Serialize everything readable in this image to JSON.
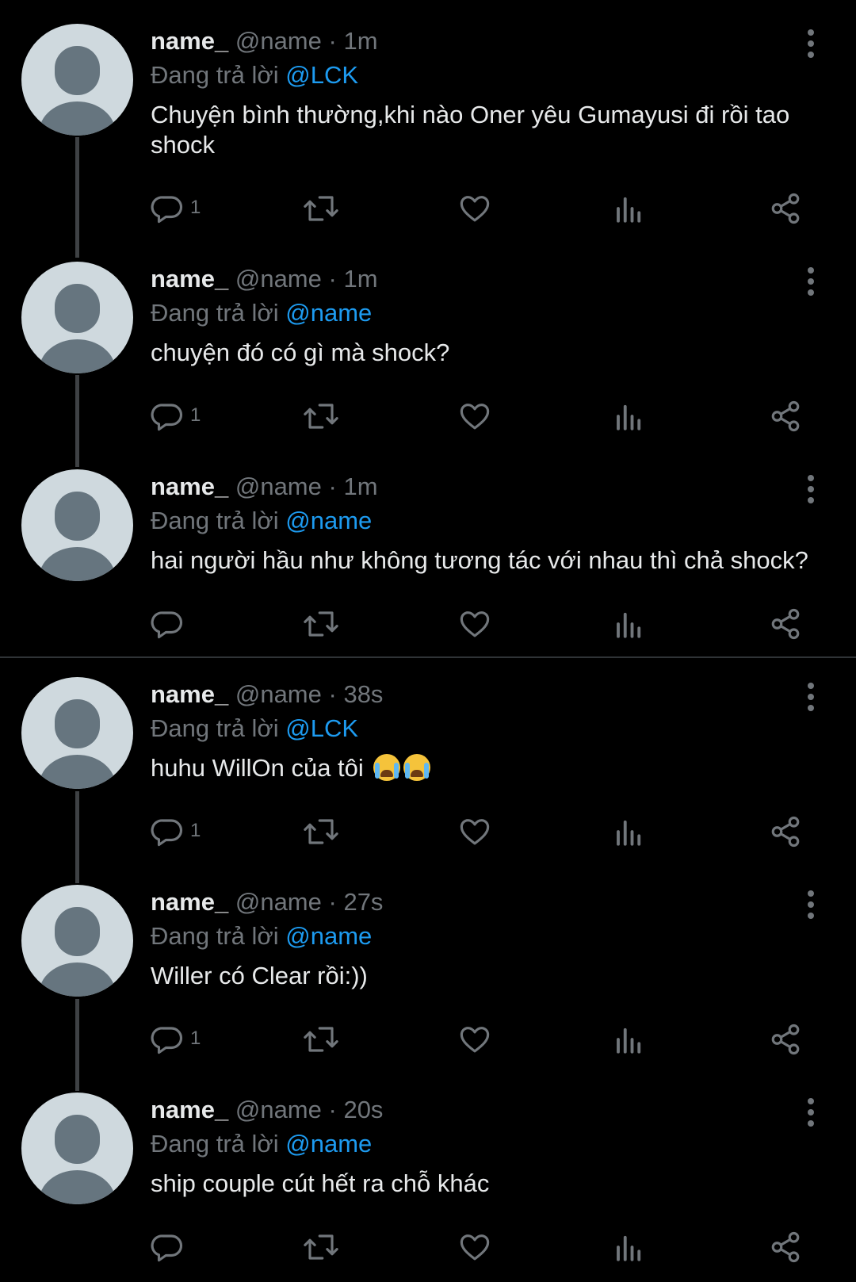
{
  "colors": {
    "background": "#000000",
    "text": "#e7e9ea",
    "muted": "#71767b",
    "mention": "#1d9bf0",
    "avatar_bg": "#cfd9de",
    "avatar_fg": "#66757f"
  },
  "tweets": [
    {
      "name": "name_",
      "handle": "@name",
      "sep": "·",
      "time": "1m",
      "reply_prefix": "Đang trả lời",
      "reply_to": "@LCK",
      "text": "Chuyện bình thường,khi nào Oner yêu Gumayusi đi rồi tao shock",
      "reply_count": "1"
    },
    {
      "name": "name_",
      "handle": "@name",
      "sep": "·",
      "time": "1m",
      "reply_prefix": "Đang trả lời",
      "reply_to": "@name",
      "text": "chuyện đó có gì mà shock?",
      "reply_count": "1"
    },
    {
      "name": "name_",
      "handle": "@name",
      "sep": "·",
      "time": "1m",
      "reply_prefix": "Đang trả lời",
      "reply_to": "@name",
      "text": "hai người hầu như không tương tác với nhau thì chả shock?",
      "reply_count": ""
    },
    {
      "name": "name_",
      "handle": "@name",
      "sep": "·",
      "time": "38s",
      "reply_prefix": "Đang trả lời",
      "reply_to": "@LCK",
      "text": "huhu WillOn của tôi",
      "emoji": "loudly-crying-face",
      "reply_count": "1"
    },
    {
      "name": "name_",
      "handle": "@name",
      "sep": "·",
      "time": "27s",
      "reply_prefix": "Đang trả lời",
      "reply_to": "@name",
      "text": "Willer có Clear rồi:))",
      "reply_count": "1"
    },
    {
      "name": "name_",
      "handle": "@name",
      "sep": "·",
      "time": "20s",
      "reply_prefix": "Đang trả lời",
      "reply_to": "@name",
      "text": "ship couple cút hết ra chỗ khác",
      "reply_count": ""
    }
  ],
  "icons": {
    "reply": "reply-icon",
    "retweet": "retweet-icon",
    "like": "heart-icon",
    "views": "views-icon",
    "share": "share-icon",
    "more": "more-options-icon"
  }
}
